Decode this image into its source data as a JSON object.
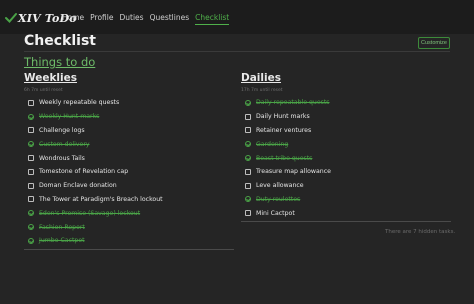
{
  "brand": {
    "name": "XIV ToDo"
  },
  "nav": [
    {
      "label": "Home",
      "active": false
    },
    {
      "label": "Profile",
      "active": false
    },
    {
      "label": "Duties",
      "active": false
    },
    {
      "label": "Questlines",
      "active": false
    },
    {
      "label": "Checklist",
      "active": true
    }
  ],
  "page": {
    "title": "Checklist",
    "customize_label": "Customize"
  },
  "section": {
    "title": "Things to do"
  },
  "weeklies": {
    "heading": "Weeklies",
    "subtitle": "6h 7m until reset",
    "items": [
      {
        "label": "Weekly repeatable quests",
        "done": false
      },
      {
        "label": "Weekly Hunt marks",
        "done": true
      },
      {
        "label": "Challenge logs",
        "done": false
      },
      {
        "label": "Custom delivery",
        "done": true
      },
      {
        "label": "Wondrous Tails",
        "done": false
      },
      {
        "label": "Tomestone of Revelation cap",
        "done": false
      },
      {
        "label": "Doman Enclave donation",
        "done": false
      },
      {
        "label": "The Tower at Paradigm's Breach lockout",
        "done": false
      },
      {
        "label": "Eden's Promise (Savage) lockout",
        "done": true
      },
      {
        "label": "Fashion Report",
        "done": true
      },
      {
        "label": "Jumbo Cactpot",
        "done": true
      }
    ]
  },
  "dailies": {
    "heading": "Dailies",
    "subtitle": "17h 7m until reset",
    "items": [
      {
        "label": "Daily repeatable quests",
        "done": true
      },
      {
        "label": "Daily Hunt marks",
        "done": false
      },
      {
        "label": "Retainer ventures",
        "done": false
      },
      {
        "label": "Gardening",
        "done": true
      },
      {
        "label": "Beast tribe quests",
        "done": true
      },
      {
        "label": "Treasure map allowance",
        "done": false
      },
      {
        "label": "Leve allowance",
        "done": false
      },
      {
        "label": "Duty roulettes",
        "done": true
      },
      {
        "label": "Mini Cactpot",
        "done": false
      }
    ]
  },
  "footer": {
    "hidden_tasks": "There are 7 hidden tasks."
  },
  "colors": {
    "accent": "#4aa347",
    "background": "#252525",
    "navbar": "#1c1c1c"
  }
}
